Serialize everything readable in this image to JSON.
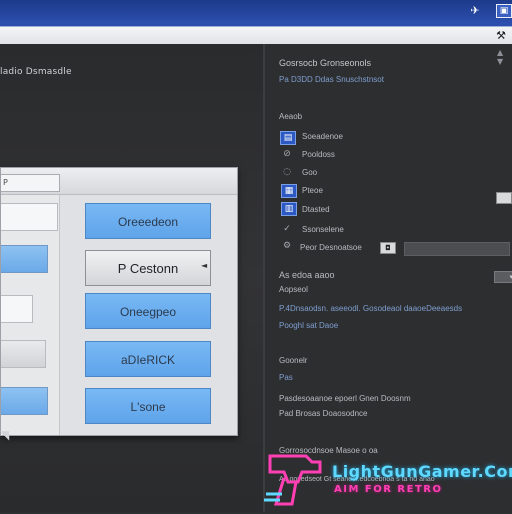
{
  "titlebar": {
    "icons": [
      "pin-icon",
      "window-box-icon",
      "wrench-icon"
    ]
  },
  "main": {
    "subtitle": "ladio Dsmasdle"
  },
  "dialog": {
    "tab_label": "P",
    "buttons": [
      {
        "label": "Oreeedeon",
        "style": "blue"
      },
      {
        "label": "P Cestonn",
        "style": "alt"
      },
      {
        "label": "Oneegpeo",
        "style": "blue"
      },
      {
        "label": "aDIeRICK",
        "style": "blue"
      },
      {
        "label": "L'sone",
        "style": "blue"
      }
    ],
    "dropdown_arrow": "◄"
  },
  "right_panel": {
    "header1": "Gosrsocb Gronseonols",
    "header1_sub": "Pa D3DD Ddas Snuschstnsot",
    "section1": "Aeaob",
    "items": [
      {
        "icon": "folder-icon",
        "label": "Soeadenoe"
      },
      {
        "icon": "search-icon",
        "label": "Pooldoss"
      },
      {
        "icon": "settings-icon",
        "label": "Goo"
      },
      {
        "icon": "image-icon",
        "label": "Pteoe"
      },
      {
        "icon": "grid-icon",
        "label": "Dtasted"
      },
      {
        "icon": "check-icon",
        "label": "Ssonselene"
      },
      {
        "icon": "gear-icon",
        "label": "Peor Desnoatsoe"
      }
    ],
    "section2": "As edoa aaoo",
    "section2_sub": "Aopseol",
    "long_line1": "P.4Dnsaodsn. aseeodl. Gosodeaol daaoeDeeaesds",
    "long_line2": "Pooghl sat Daoe",
    "section3": "Goonelr",
    "section3_sub": "Pas",
    "line4": "Pasdesoaanoe epoerl Gnen Doosnm",
    "line5": "Pad Brosas Doaosodnce",
    "line6": "Gorrosocdnsoe Masoe o oa",
    "line7": "Aa oosedseot Gt seaneel.edcoebnoa s ta nd anao"
  },
  "watermark": {
    "brand": "LightGunGamer.Com",
    "tagline": "AIM FOR RETRO"
  },
  "colors": {
    "accent_blue": "#6aa9e8",
    "panel_bg": "#2d2e30",
    "titlebar_blue": "#2c4fb0",
    "watermark_cyan": "#5fd9ff",
    "watermark_pink": "#ff3fb3"
  }
}
